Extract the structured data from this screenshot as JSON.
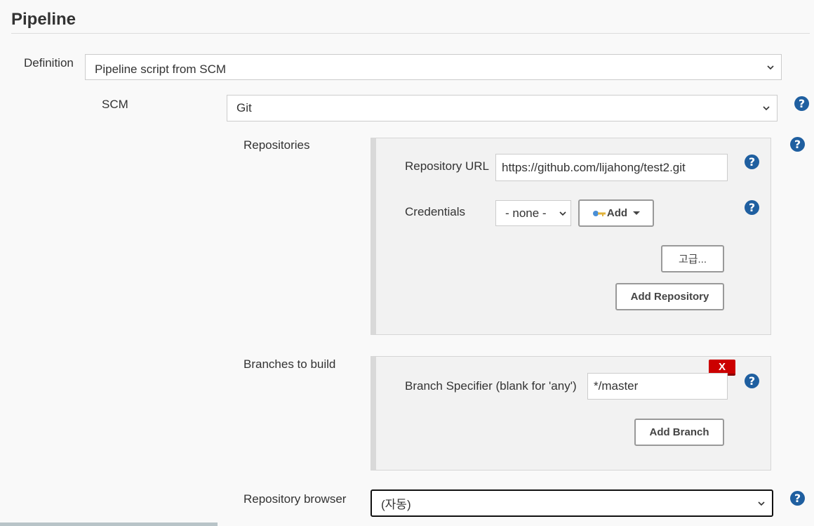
{
  "section": {
    "title": "Pipeline"
  },
  "definition": {
    "label": "Definition",
    "selected": "Pipeline script from SCM"
  },
  "scm": {
    "label": "SCM",
    "selected": "Git"
  },
  "repositories": {
    "label": "Repositories",
    "url_label": "Repository URL",
    "url_value": "https://github.com/lijahong/test2.git",
    "credentials_label": "Credentials",
    "credentials_selected": "- none -",
    "add_label": "Add",
    "advanced_label": "고급...",
    "add_repository_label": "Add Repository"
  },
  "branches": {
    "label": "Branches to build",
    "specifier_label": "Branch Specifier (blank for 'any')",
    "specifier_value": "*/master",
    "delete_label": "X",
    "add_branch_label": "Add Branch"
  },
  "repository_browser": {
    "label": "Repository browser",
    "selected": "(자동)"
  },
  "help_icon_glyph": "?",
  "colors": {
    "help": "#1f5fa0",
    "delete": "#cc0000",
    "panel": "#f2f2f2"
  }
}
